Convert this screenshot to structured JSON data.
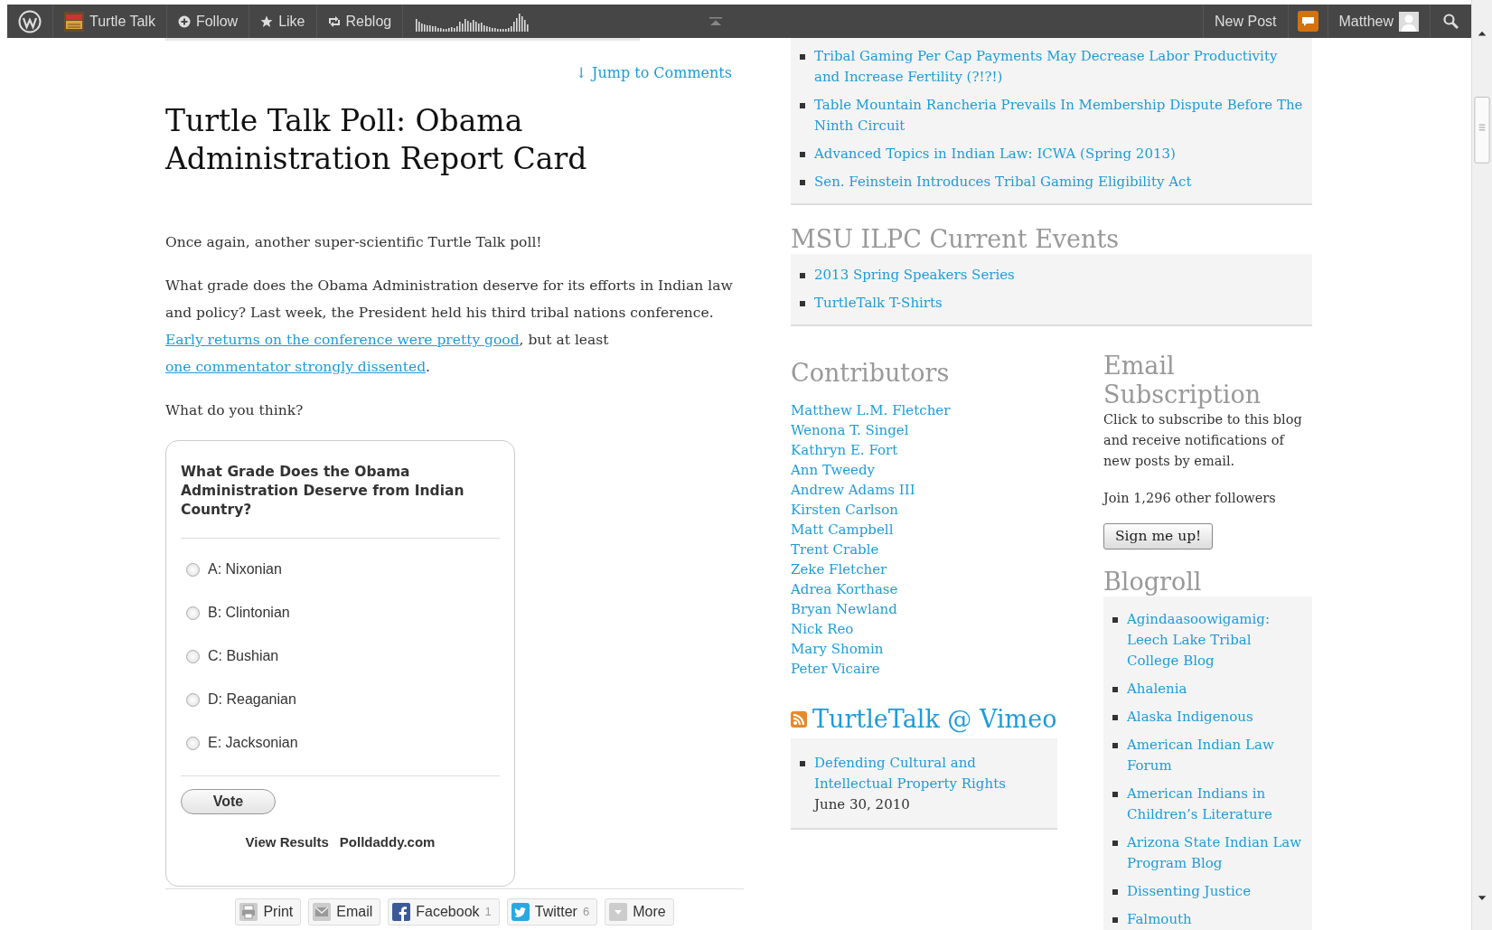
{
  "admin_bar": {
    "site": "Turtle Talk",
    "actions": [
      {
        "kind": "follow",
        "label": "Follow"
      },
      {
        "kind": "like",
        "label": "Like"
      },
      {
        "kind": "reblog",
        "label": "Reblog"
      }
    ],
    "new_post": "New Post",
    "notifications_unread": true,
    "user": "Matthew"
  },
  "post": {
    "jump_link": "↓ Jump to Comments",
    "title": "Turtle Talk Poll: Obama Administration Report Card",
    "paragraphs": [
      [
        {
          "kind": "text",
          "text": "Once again, another super-scientific Turtle Talk poll!"
        }
      ],
      [
        {
          "kind": "text",
          "text": "What grade does the Obama Administration deserve for its efforts in Indian law and policy? Last week, the President held his third tribal nations conference. "
        },
        {
          "kind": "link",
          "text": "Early returns on the conference were pretty good"
        },
        {
          "kind": "text",
          "text": ", but at least "
        },
        {
          "kind": "link",
          "text": "one commentator strongly dissented"
        },
        {
          "kind": "text",
          "text": "."
        }
      ],
      [
        {
          "kind": "text",
          "text": "What do you think?"
        }
      ]
    ],
    "poll": {
      "question": "What Grade Does the Obama Administration Deserve from Indian Country?",
      "options": [
        {
          "label": "A: Nixonian",
          "selected": false
        },
        {
          "label": "B: Clintonian",
          "selected": false
        },
        {
          "label": "C: Bushian",
          "selected": false
        },
        {
          "label": "D: Reaganian",
          "selected": false
        },
        {
          "label": "E: Jacksonian",
          "selected": false
        }
      ],
      "vote_button": "Vote",
      "view_results": "View Results",
      "credit": "Polldaddy.com"
    },
    "share": [
      {
        "kind": "print",
        "label": "Print"
      },
      {
        "kind": "email",
        "label": "Email"
      },
      {
        "kind": "facebook",
        "label": "Facebook",
        "count": "1"
      },
      {
        "kind": "twitter",
        "label": "Twitter",
        "count": "6"
      },
      {
        "kind": "more",
        "label": "More"
      }
    ]
  },
  "sidebar": {
    "recent_posts": [
      "Tribal Gaming Per Cap Payments May Decrease Labor Productivity and Increase Fertility (?!?!)",
      "Table Mountain Rancheria Prevails In Membership Dispute Before The Ninth Circuit",
      "Advanced Topics in Indian Law: ICWA (Spring 2013)",
      "Sen. Feinstein Introduces Tribal Gaming Eligibility Act"
    ],
    "events": {
      "title": "MSU ILPC Current Events",
      "items": [
        "2013 Spring Speakers Series",
        "TurtleTalk T-Shirts"
      ]
    },
    "contributors": {
      "title": "Contributors",
      "names": [
        "Matthew L.M. Fletcher",
        "Wenona T. Singel",
        "Kathryn E. Fort",
        "Ann Tweedy",
        "Andrew Adams III",
        "Kirsten Carlson",
        "Matt Campbell",
        "Trent Crable",
        "Zeke Fletcher",
        "Adrea Korthase",
        "Bryan Newland",
        "Nick Reo",
        "Mary Shomin",
        "Peter Vicaire"
      ]
    },
    "vimeo": {
      "title": "TurtleTalk @ Vimeo",
      "items": [
        {
          "link": "Defending Cultural and Intellectual Property Rights",
          "date": "June 30, 2010"
        }
      ]
    },
    "email": {
      "title": "Email Subscription",
      "description": "Click to subscribe to this blog and receive notifications of new posts by email.",
      "followers": "Join 1,296 other followers",
      "button": "Sign me up!"
    },
    "blogroll": {
      "title": "Blogroll",
      "items": [
        "Agindaasoowigamig: Leech Lake Tribal College Blog",
        "Ahalenia",
        "Alaska Indigenous",
        "American Indian Law Forum",
        "American Indians in Children’s Literature",
        "Arizona State Indian Law Program Blog",
        "Dissenting Justice",
        "Falmouth"
      ]
    }
  }
}
